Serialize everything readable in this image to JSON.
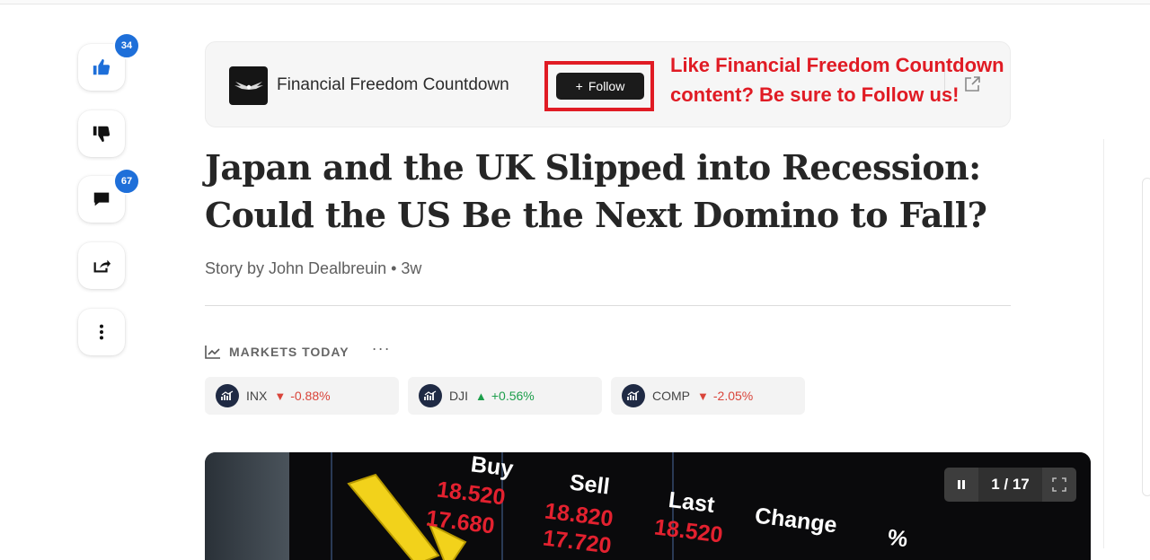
{
  "rail": {
    "like_count": "34",
    "comment_count": "67"
  },
  "publisher": {
    "name": "Financial Freedom Countdown",
    "follow_label": "Follow",
    "follow_plus": "+"
  },
  "annotation": {
    "promo_text": "Like Financial Freedom Countdown content? Be sure to Follow us!"
  },
  "article": {
    "headline": "Japan and the UK Slipped into Recession: Could the US Be the Next Domino to Fall?",
    "byline": "Story by John Dealbreuin • 3w"
  },
  "markets": {
    "label": "MARKETS TODAY",
    "more": "···",
    "tickers": [
      {
        "symbol": "INX",
        "direction": "down",
        "arrow": "▼",
        "change": "-0.88%"
      },
      {
        "symbol": "DJI",
        "direction": "up",
        "arrow": "▲",
        "change": "+0.56%"
      },
      {
        "symbol": "COMP",
        "direction": "down",
        "arrow": "▼",
        "change": "-2.05%"
      }
    ]
  },
  "gallery": {
    "counter": "1 / 17",
    "image_words": [
      "Buy",
      "Sell",
      "Last",
      "Change",
      "%"
    ],
    "image_numbers": [
      "18.520",
      "18.820",
      "18.520",
      "17.680",
      "17.720"
    ]
  },
  "colors": {
    "badge": "#1e6fd9",
    "highlight": "#e01b24",
    "down": "#d9443a",
    "up": "#1d9e4b"
  }
}
